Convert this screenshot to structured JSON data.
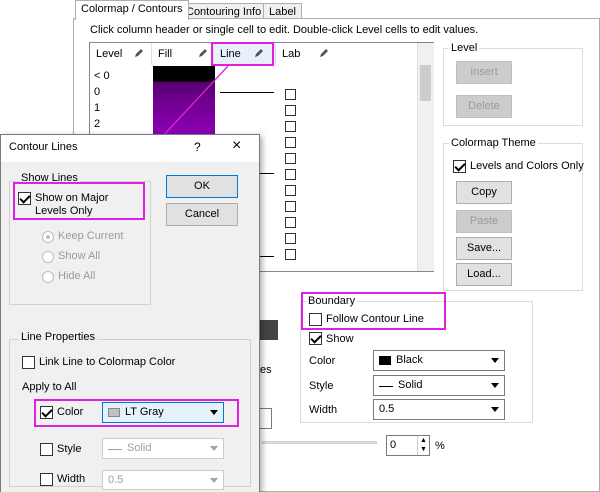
{
  "tabs": [
    {
      "label": "Colormap / Contours"
    },
    {
      "label": "Contouring Info"
    },
    {
      "label": "Label"
    }
  ],
  "instructions": "Click column header or single cell to edit. Double-click Level cells to edit values.",
  "grid": {
    "headers": {
      "level": "Level",
      "fill": "Fill",
      "line": "Line",
      "label": "Lab"
    },
    "levels": [
      "< 0",
      "0",
      "1",
      "2"
    ]
  },
  "level_group": {
    "title": "Level",
    "insert": "Insert",
    "delete": "Delete"
  },
  "colormap_theme": {
    "title": "Colormap Theme",
    "levels_colors_only": "Levels and Colors Only",
    "copy": "Copy",
    "paste": "Paste",
    "save": "Save...",
    "load": "Load..."
  },
  "boundary": {
    "title": "Boundary",
    "follow_contour": "Follow Contour Line",
    "show": "Show",
    "color_label": "Color",
    "color_value": "Black",
    "style_label": "Style",
    "style_value": "Solid",
    "width_label": "Width",
    "width_value": "0.5"
  },
  "partial_es": "es",
  "percent_value": "0",
  "percent_sign": "%",
  "dialog": {
    "title": "Contour Lines",
    "help": "?",
    "close": "×",
    "show_lines": "Show Lines",
    "show_major": "Show on Major Levels Only",
    "ok": "OK",
    "cancel": "Cancel",
    "keep_current": "Keep Current",
    "show_all": "Show All",
    "hide_all": "Hide All",
    "line_properties": "Line Properties",
    "link_line": "Link Line to Colormap Color",
    "apply_to_all": "Apply to All",
    "color_label": "Color",
    "color_value": "LT Gray",
    "style_label": "Style",
    "style_value": "Solid",
    "width_label": "Width",
    "width_value": "0.5"
  },
  "colors": {
    "highlight": "#e020e0",
    "fill_top": "#000000",
    "fill_purple": "#6e008c",
    "arrow": "#e020e0"
  }
}
